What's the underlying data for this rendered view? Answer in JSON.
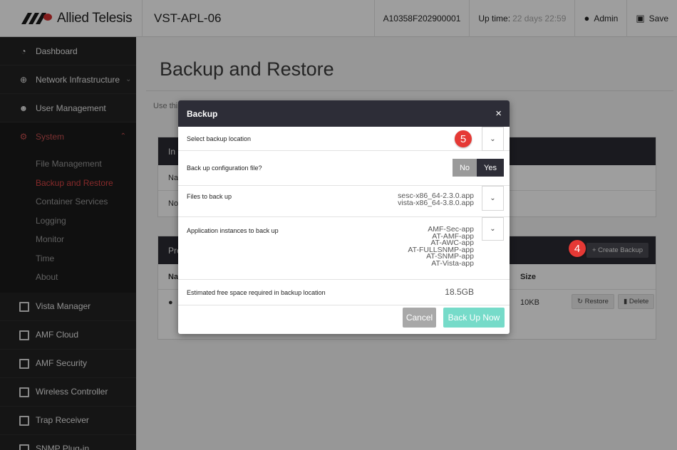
{
  "header": {
    "logo_text": "Allied Telesis",
    "device_name": "VST-APL-06",
    "serial": "A10358F202900001",
    "uptime_label": "Up time:",
    "uptime_value": "22 days 22:59",
    "user_label": "Admin",
    "save_label": "Save"
  },
  "sidebar": {
    "items": [
      {
        "label": "Dashboard",
        "icon": "dashboard-icon"
      },
      {
        "label": "Network Infrastructure",
        "icon": "globe-icon"
      },
      {
        "label": "User Management",
        "icon": "users-icon"
      },
      {
        "label": "System",
        "icon": "gear-icon"
      }
    ],
    "system_sub": [
      "File Management",
      "Backup and Restore",
      "Container Services",
      "Logging",
      "Monitor",
      "Time",
      "About"
    ],
    "apps": [
      "Vista Manager",
      "AMF Cloud",
      "AMF Security",
      "Wireless Controller",
      "Trap Receiver",
      "SNMP Plug-in"
    ]
  },
  "main": {
    "title": "Backup and Restore",
    "description": "Use thi",
    "panel1": {
      "head": "In B",
      "row1": "Na",
      "row2": "No"
    },
    "panel2": {
      "head": "Pre",
      "create_label": "+ Create Backup",
      "col_name": "Na",
      "col_size": "Size",
      "row_size": "10KB",
      "restore_label": "Restore",
      "delete_label": "Delete"
    }
  },
  "badges": {
    "step4": "4",
    "step5": "5"
  },
  "modal": {
    "title": "Backup",
    "close": "×",
    "location_label": "Select backup location",
    "config_label": "Back up configuration file?",
    "toggle_no": "No",
    "toggle_yes": "Yes",
    "files_label": "Files to back up",
    "files": [
      "sesc-x86_64-2.3.0.app",
      "vista-x86_64-3.8.0.app"
    ],
    "instances_label": "Application instances to back up",
    "instances": [
      "AMF-Sec-app",
      "AT-AMF-app",
      "AT-AWC-app",
      "AT-FULLSNMP-app",
      "AT-SNMP-app",
      "AT-Vista-app"
    ],
    "space_label": "Estimated free space required in backup location",
    "space_value": "18.5GB",
    "cancel_label": "Cancel",
    "backup_label": "Back Up Now"
  },
  "colors": {
    "accent_red": "#d84444",
    "teal_button": "#76dbc9",
    "dark_header": "#2d2d37",
    "badge_red": "#e53935"
  }
}
